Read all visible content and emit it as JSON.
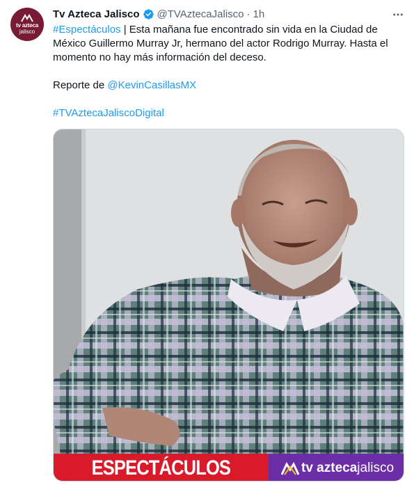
{
  "account": {
    "display_name": "Tv Azteca Jalisco",
    "handle": "@TVAztecaJalisco",
    "separator": "·",
    "time": "1h",
    "avatar_line1": "tv azteca",
    "avatar_line2": "jalisco",
    "verified_icon": "verified-badge-icon"
  },
  "tweet": {
    "hashtag": "#Espectáculos",
    "body": " | Esta mañana fue encontrado sin vida en la Ciudad de México Guillermo Murray Jr, hermano del actor Rodrigo Murray. Hasta el momento no hay más información del deceso.",
    "report_prefix": "Reporte de ",
    "mention": "@KevinCasillasMX",
    "hashtag2": "#TVAztecaJaliscoDigital"
  },
  "media": {
    "banner_left": "ESPECTÁCULOS",
    "banner_brand": "tv azteca",
    "banner_location": "jalisco"
  },
  "colors": {
    "link": "#1d9bf0",
    "verified": "#1d9bf0",
    "banner_red": "#d81a2a",
    "banner_purple": "#6b2ea6",
    "avatar_bg": "#7a1b35"
  },
  "icons": {
    "more": "more-horizontal-icon"
  }
}
